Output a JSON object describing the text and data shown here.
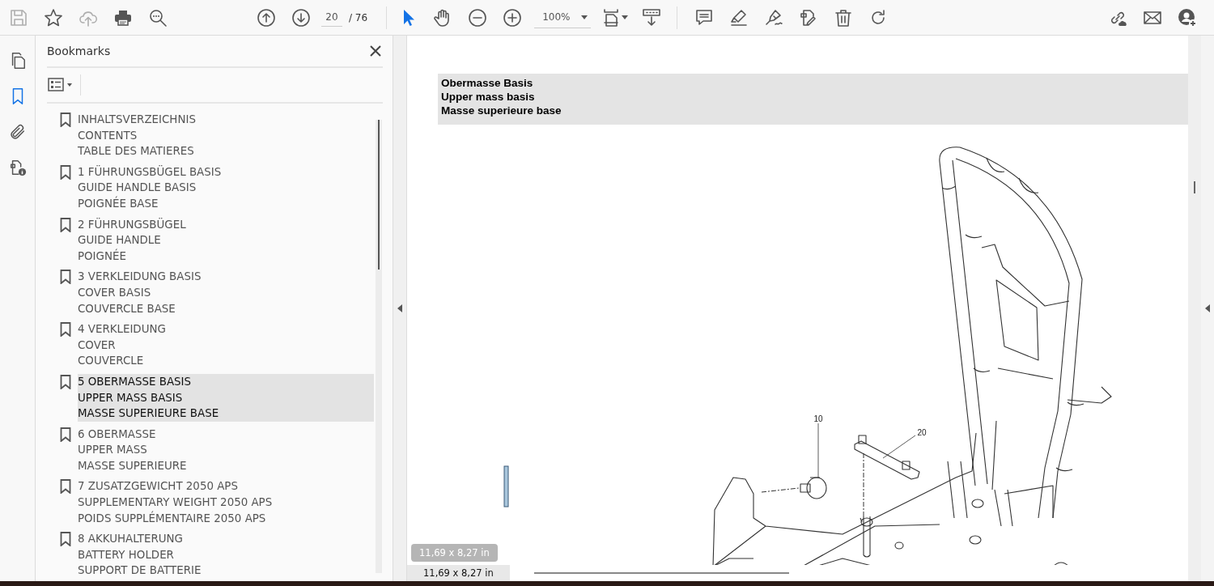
{
  "toolbar": {
    "file_tools": [
      {
        "kind": "save",
        "disabled": true
      },
      {
        "kind": "star",
        "disabled": false
      },
      {
        "kind": "upload",
        "disabled": true
      },
      {
        "kind": "print",
        "disabled": false
      },
      {
        "kind": "find",
        "disabled": false
      }
    ],
    "page_nav": {
      "current": "20",
      "total": "/ 76"
    },
    "view_tools": [
      {
        "kind": "pointer",
        "selected": true
      },
      {
        "kind": "hand",
        "selected": false
      }
    ],
    "zoom": {
      "value": "100%"
    },
    "edit_tools": [
      {
        "kind": "comment"
      },
      {
        "kind": "highlight"
      },
      {
        "kind": "sign"
      },
      {
        "kind": "edit"
      },
      {
        "kind": "delete"
      },
      {
        "kind": "rotate"
      }
    ],
    "share_tools": [
      {
        "kind": "link"
      },
      {
        "kind": "mail"
      },
      {
        "kind": "user"
      }
    ]
  },
  "sidebar": {
    "items": [
      {
        "kind": "pages",
        "selected": false
      },
      {
        "kind": "bookmarks",
        "selected": true
      },
      {
        "kind": "attachments",
        "selected": false
      },
      {
        "kind": "info",
        "selected": false
      }
    ]
  },
  "bookmarks": {
    "title": "Bookmarks",
    "items": [
      {
        "lines": [
          "INHALTSVERZEICHNIS",
          "CONTENTS",
          "TABLE DES MATIERES"
        ],
        "selected": false
      },
      {
        "lines": [
          "1 FÜHRUNGSBÜGEL BASIS",
          "GUIDE HANDLE BASIS",
          "POIGNÉE BASE"
        ],
        "selected": false
      },
      {
        "lines": [
          "2 FÜHRUNGSBÜGEL",
          "GUIDE HANDLE",
          "POIGNÉE"
        ],
        "selected": false
      },
      {
        "lines": [
          "3 VERKLEIDUNG BASIS",
          "COVER BASIS",
          "COUVERCLE BASE"
        ],
        "selected": false
      },
      {
        "lines": [
          "4 VERKLEIDUNG",
          "COVER",
          "COUVERCLE"
        ],
        "selected": false
      },
      {
        "lines": [
          "5 OBERMASSE BASIS",
          "UPPER MASS BASIS",
          "MASSE SUPERIEURE BASE"
        ],
        "selected": true
      },
      {
        "lines": [
          "6 OBERMASSE",
          "UPPER MASS",
          "MASSE SUPERIEURE"
        ],
        "selected": false
      },
      {
        "lines": [
          "7 ZUSATZGEWICHT 2050 APS",
          "SUPPLEMENTARY WEIGHT 2050 APS",
          "POIDS SUPPLÉMENTAIRE 2050 APS"
        ],
        "selected": false
      },
      {
        "lines": [
          "8 AKKUHALTERUNG",
          "BATTERY HOLDER",
          "SUPPORT DE BATTERIE"
        ],
        "selected": false
      }
    ]
  },
  "page": {
    "header": [
      "Obermasse Basis",
      "Upper mass basis",
      "Masse superieure base"
    ],
    "callouts": [
      "10",
      "20"
    ],
    "size_tooltip": "11,69 x 8,27 in"
  },
  "status_bar": {
    "page_size": "11,69 x 8,27 in"
  }
}
